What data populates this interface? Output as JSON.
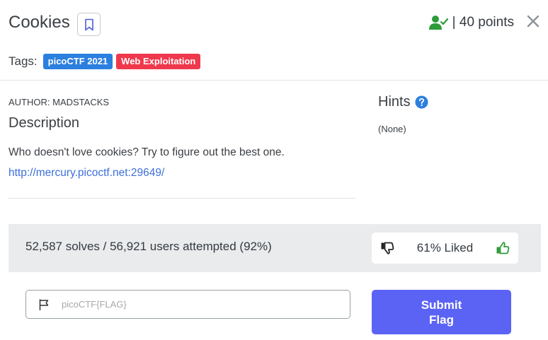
{
  "challenge": {
    "title": "Cookies",
    "points": "| 40 points",
    "tags_label": "Tags:",
    "tags": [
      {
        "label": "picoCTF 2021",
        "color": "#2b7fdf"
      },
      {
        "label": "Web Exploitation",
        "color": "#f0384d"
      }
    ],
    "author": "AUTHOR: MADSTACKS",
    "description_heading": "Description",
    "description_text": "Who doesn't love cookies? Try to figure out the best one.",
    "link": "http://mercury.picoctf.net:29649/",
    "hints_heading": "Hints",
    "hints_text": "(None)"
  },
  "stats": {
    "solves_text": "52,587 solves / 56,921 users attempted (92%)",
    "liked_text": "61% Liked",
    "liked_percent": 61
  },
  "flag_form": {
    "placeholder": "picoCTF{FLAG}",
    "value": "",
    "submit_label": "Submit Flag"
  },
  "icons": {
    "bookmark": "bookmark-icon",
    "user_check": "user-check-icon",
    "close": "close-icon",
    "help": "help-icon",
    "thumbs_down": "thumbs-down-icon",
    "thumbs_up": "thumbs-up-icon",
    "flag": "flag-icon"
  },
  "colors": {
    "accent": "#5b63f5",
    "link": "#3d6fd9",
    "success": "#2e9b3a",
    "help": "#2b7fdf"
  }
}
